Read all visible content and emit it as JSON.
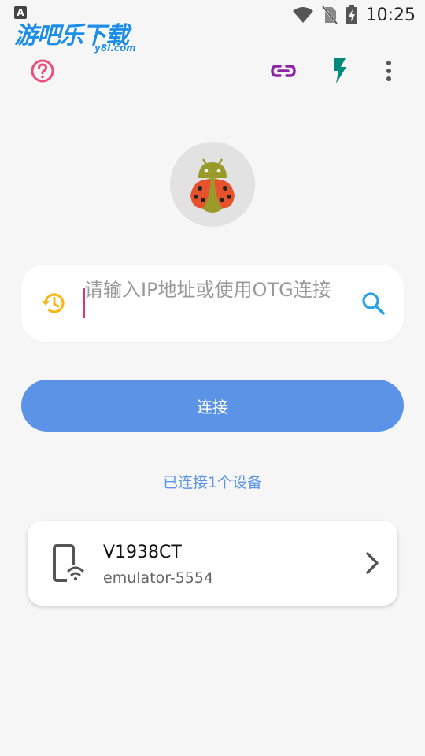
{
  "status_bar": {
    "notification_icon": "A",
    "time": "10:25",
    "icons": [
      "wifi-icon",
      "no-sim-icon",
      "battery-charging-icon"
    ]
  },
  "watermark": {
    "main": "游吧乐下载",
    "sub": "y8l.com"
  },
  "toolbar": {
    "icons": [
      "help-icon",
      "link-icon",
      "flash-icon",
      "more-vert-icon"
    ],
    "colors": {
      "help": "#e9517a",
      "link": "#8e24aa",
      "flash": "#00897b",
      "more": "#555555"
    }
  },
  "connect_form": {
    "ip_placeholder": "请输入IP地址或使用OTG连接",
    "ip_value": "",
    "connect_label": "连接"
  },
  "connection_status": "已连接1个设备",
  "devices": [
    {
      "name": "V1938CT",
      "serial": "emulator-5554"
    }
  ],
  "colors": {
    "accent": "#5b93e6",
    "history_icon": "#f6b81c",
    "search_icon": "#29a3e0",
    "caret": "#e0356f"
  }
}
